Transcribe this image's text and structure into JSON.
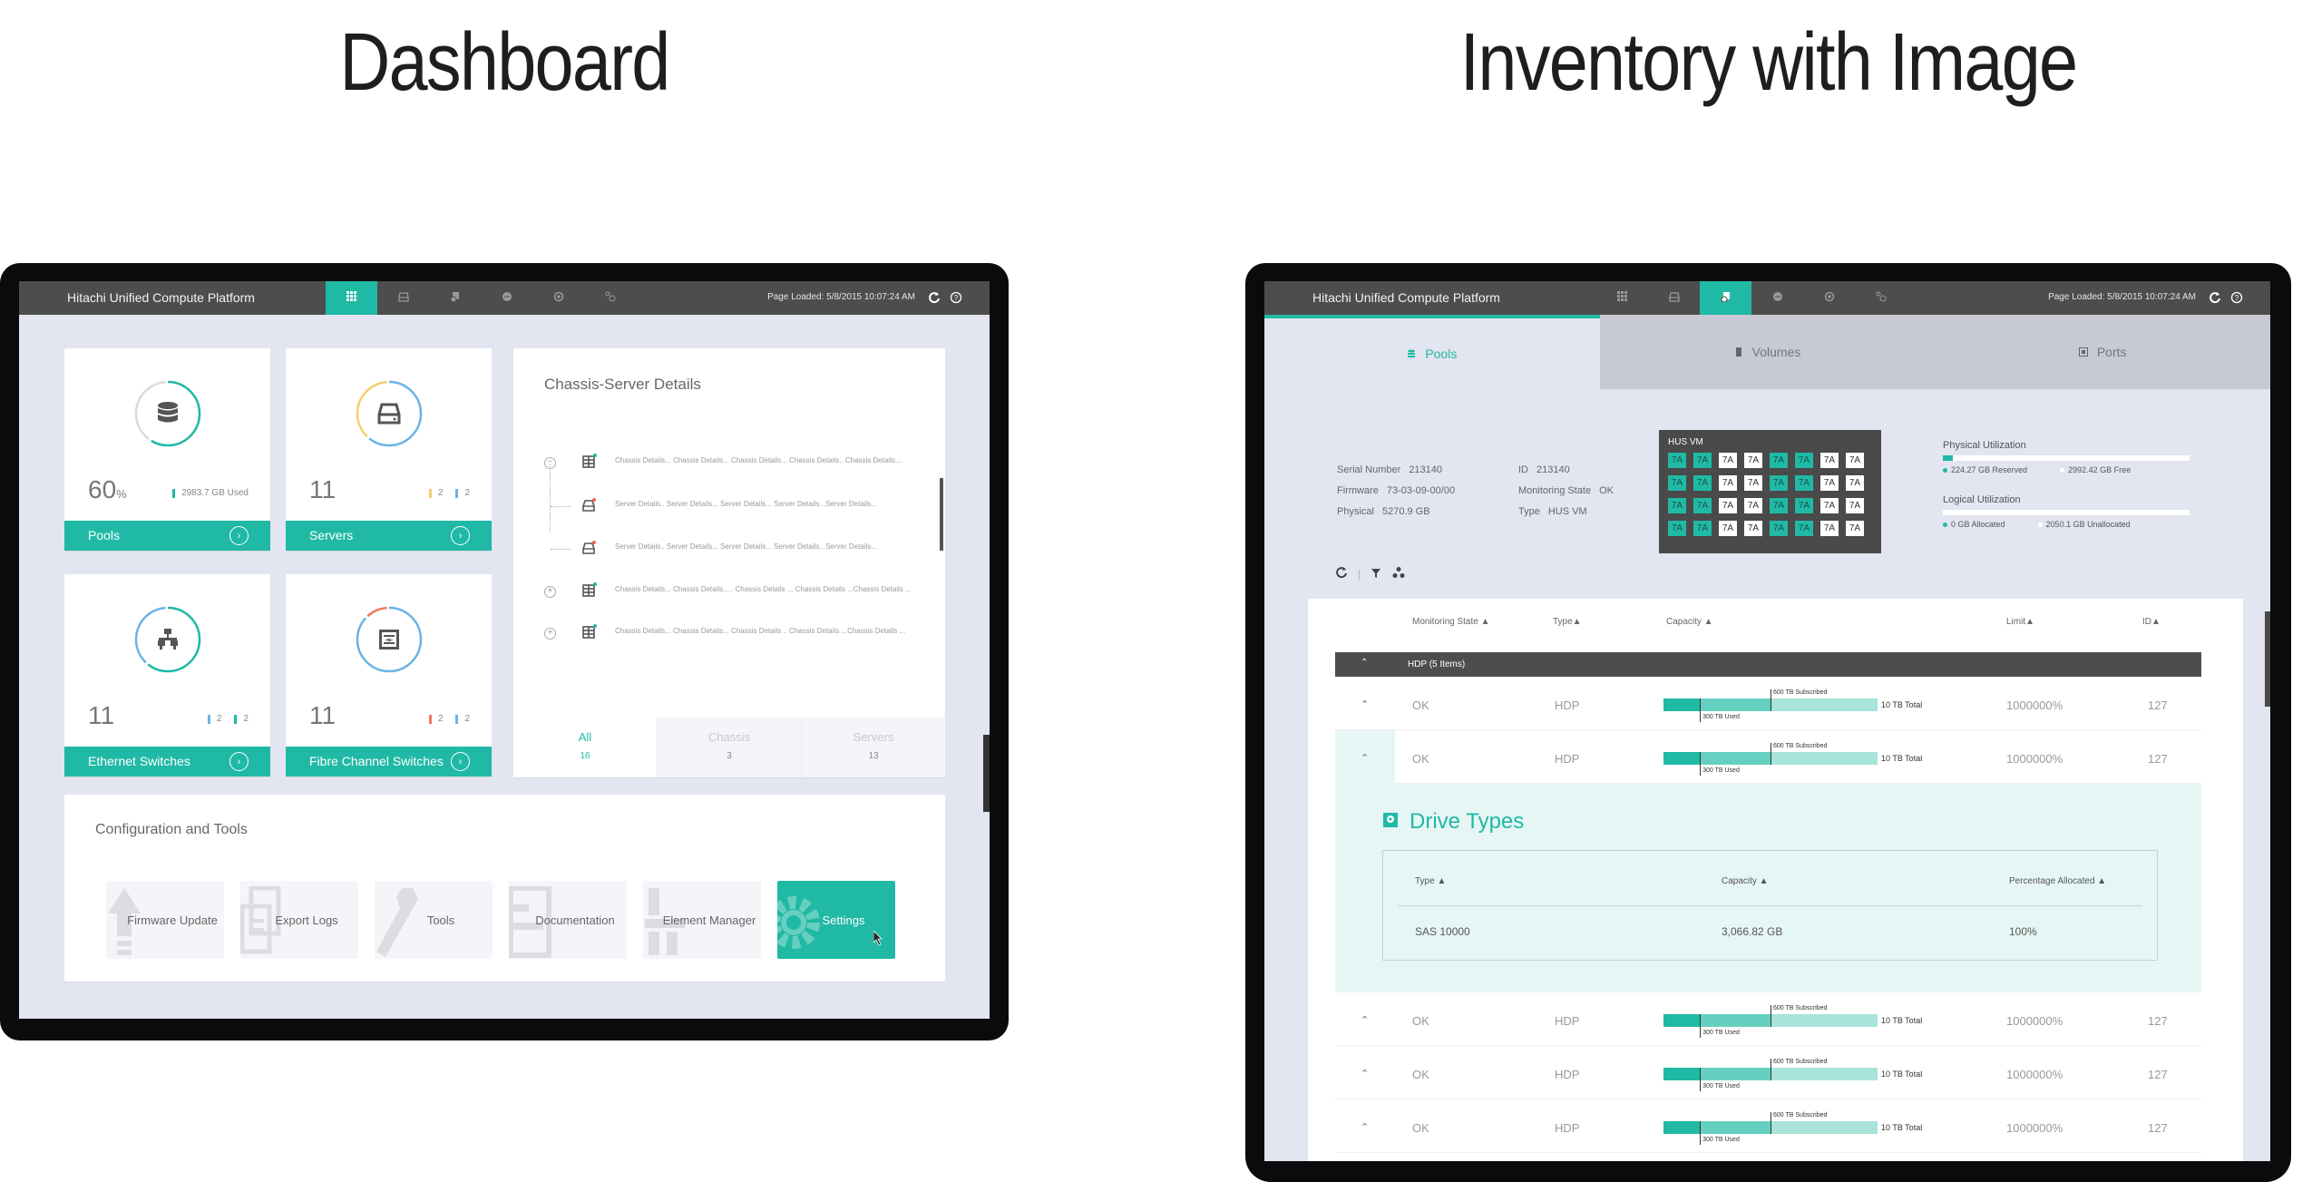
{
  "titles": {
    "left": "Dashboard",
    "right": "Inventory with Image"
  },
  "app": {
    "title": "Hitachi Unified Compute Platform",
    "page_loaded": "Page Loaded: 5/8/2015 10:07:24 AM",
    "nav_icons": [
      "dashboard-grid-icon",
      "server-icon",
      "storage-icon",
      "network-icon",
      "fibre-channel-icon",
      "settings-link-icon"
    ]
  },
  "dashboard": {
    "cards": [
      {
        "name": "pools",
        "label": "Pools",
        "value": "60",
        "unit": "%",
        "legend": [
          {
            "color": "#20b9a5",
            "text": "2983.7 GB Used"
          }
        ],
        "ring": [
          {
            "color": "#20b9a5",
            "fraction": 0.6
          },
          {
            "color": "#d9dbe0",
            "fraction": 0.4
          }
        ]
      },
      {
        "name": "servers",
        "label": "Servers",
        "value": "11",
        "unit": "",
        "legend": [
          {
            "color": "#f7cd6a",
            "text": "2"
          },
          {
            "color": "#6ab3e6",
            "text": "2"
          }
        ],
        "ring": [
          {
            "color": "#6ab3e6",
            "fraction": 0.62
          },
          {
            "color": "#f7cd6a",
            "fraction": 0.38
          }
        ]
      },
      {
        "name": "ethernet-switches",
        "label": "Ethernet Switches",
        "value": "11",
        "unit": "",
        "legend": [
          {
            "color": "#6ab3e6",
            "text": "2"
          },
          {
            "color": "#20b9a5",
            "text": "2"
          }
        ],
        "ring": [
          {
            "color": "#20b9a5",
            "fraction": 0.62
          },
          {
            "color": "#6ab3e6",
            "fraction": 0.38
          }
        ]
      },
      {
        "name": "fibre-channel-switches",
        "label": "Fibre Channel Switches",
        "value": "11",
        "unit": "",
        "legend": [
          {
            "color": "#f0785a",
            "text": "2"
          },
          {
            "color": "#6ab3e6",
            "text": "2"
          }
        ],
        "ring": [
          {
            "color": "#6ab3e6",
            "fraction": 0.88
          },
          {
            "color": "#f0785a",
            "fraction": 0.12
          }
        ]
      }
    ],
    "chassis_panel": {
      "title": "Chassis-Server Details",
      "rows": [
        {
          "kind": "chassis",
          "toggle": "−",
          "text": "Chassis Details... Chassis Details... Chassis Details... Chassis Details.. Chassis Details..."
        },
        {
          "kind": "server",
          "toggle": "",
          "text": "Server Details.. Server Details... Server Details... Server Details...Server Details..."
        },
        {
          "kind": "server",
          "toggle": "",
          "text": "Server Details.. Server Details...  Server Details... Server Details...Server Details..."
        },
        {
          "kind": "chassis",
          "toggle": "+",
          "text": "Chassis Details... Chassis Details.....   Chassis Details ... Chassis Details ...Chassis Details ..."
        },
        {
          "kind": "chassis",
          "toggle": "+",
          "text": "Chassis Details... Chassis Details... Chassis Details .. Chassis Details ...Chassis Details ..."
        }
      ],
      "tabs": [
        {
          "label": "All",
          "count": "16",
          "active": true
        },
        {
          "label": "Chassis",
          "count": "3",
          "active": false
        },
        {
          "label": "Servers",
          "count": "13",
          "active": false
        }
      ]
    },
    "config": {
      "title": "Configuration and Tools",
      "tools": [
        {
          "label": "Firmware Update",
          "icon": "upload-arrow-icon",
          "active": false
        },
        {
          "label": "Export Logs",
          "icon": "export-logs-icon",
          "active": false
        },
        {
          "label": "Tools",
          "icon": "wrench-icon",
          "active": false
        },
        {
          "label": "Documentation",
          "icon": "document-icon",
          "active": false
        },
        {
          "label": "Element Manager",
          "icon": "element-manager-icon",
          "active": false
        },
        {
          "label": "Settings",
          "icon": "gear-icon",
          "active": true
        }
      ]
    }
  },
  "inventory": {
    "tabs": [
      {
        "label": "Pools",
        "icon": "pools-icon",
        "active": true
      },
      {
        "label": "Volumes",
        "icon": "volumes-icon",
        "active": false
      },
      {
        "label": "Ports",
        "icon": "ports-icon",
        "active": false
      }
    ],
    "info_left": [
      {
        "label": "Serial Number",
        "value": "213140"
      },
      {
        "label": "Firmware",
        "value": "73-03-09-00/00"
      },
      {
        "label": "Physical",
        "value": "5270.9 GB"
      }
    ],
    "info_right": [
      {
        "label": "ID",
        "value": "213140"
      },
      {
        "label": "Monitoring State",
        "value": "OK"
      },
      {
        "label": "Type",
        "value": "HUS VM"
      }
    ],
    "hus": {
      "title": "HUS VM",
      "cell_label": "7A",
      "rows": [
        [
          1,
          1,
          0,
          0,
          1,
          1,
          0,
          0
        ],
        [
          1,
          1,
          0,
          0,
          1,
          1,
          0,
          0
        ],
        [
          1,
          1,
          0,
          0,
          1,
          1,
          0,
          0
        ],
        [
          1,
          1,
          0,
          0,
          1,
          1,
          0,
          0
        ]
      ]
    },
    "physical_util": {
      "title": "Physical Utilization",
      "fraction": 0.04,
      "a": "224.27 GB Reserved",
      "b": "2992.42 GB Free"
    },
    "logical_util": {
      "title": "Logical Utilization",
      "fraction": 0.0,
      "a": "0 GB Allocated",
      "b": "2050.1 GB Unallocated"
    },
    "table": {
      "headers": [
        "Monitoring State ▲",
        "Type▲",
        "Capacity ▲",
        "Limit▲",
        "ID▲"
      ],
      "group": "HDP (5 Items)",
      "rows": [
        {
          "state": "OK",
          "type": "HDP",
          "limit": "1000000%",
          "id": "127",
          "expanded": false
        },
        {
          "state": "OK",
          "type": "HDP",
          "limit": "1000000%",
          "id": "127",
          "expanded": true
        },
        {
          "state": "OK",
          "type": "HDP",
          "limit": "1000000%",
          "id": "127",
          "expanded": false
        },
        {
          "state": "OK",
          "type": "HDP",
          "limit": "1000000%",
          "id": "127",
          "expanded": false
        },
        {
          "state": "OK",
          "type": "HDP",
          "limit": "1000000%",
          "id": "127",
          "expanded": false
        }
      ],
      "capacity": {
        "used_label": "300 TB Used",
        "subscribed_label": "600 TB Subscribed",
        "total_label": "10 TB Total",
        "used_fraction": 0.17,
        "subscribed_fraction": 0.5
      },
      "drive_types": {
        "title": "Drive Types",
        "headers": [
          "Type ▲",
          "Capacity ▲",
          "Percentage Allocated ▲"
        ],
        "rows": [
          {
            "type": "SAS 10000",
            "capacity": "3,066.82 GB",
            "pct": "100%"
          }
        ]
      }
    }
  }
}
